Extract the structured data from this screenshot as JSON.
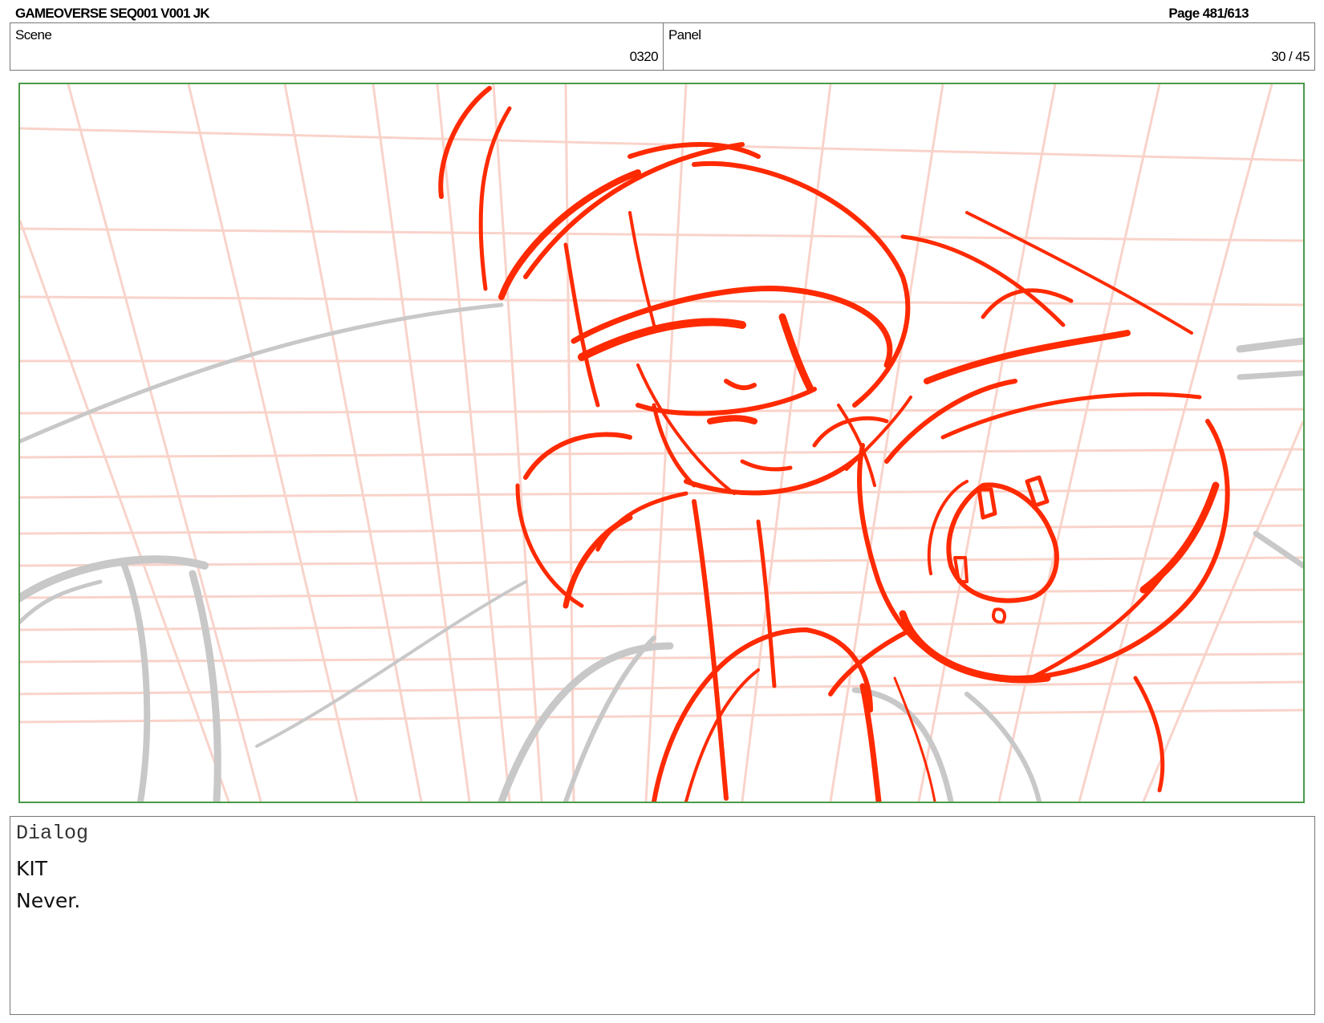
{
  "header": {
    "title": "GAMEOVERSE SEQ001 V001 JK",
    "page": "Page 481/613"
  },
  "scene": {
    "label": "Scene",
    "value": "0320"
  },
  "panel": {
    "label": "Panel",
    "value": "30 / 45"
  },
  "frame": {
    "border_color": "#4a9a4a",
    "grid_color": "#f6c6bb",
    "sketch_color": "#ff2a00",
    "rough_color": "#c8c8c8"
  },
  "dialog": {
    "label": "Dialog",
    "speaker": "KIT",
    "line": "Never."
  }
}
